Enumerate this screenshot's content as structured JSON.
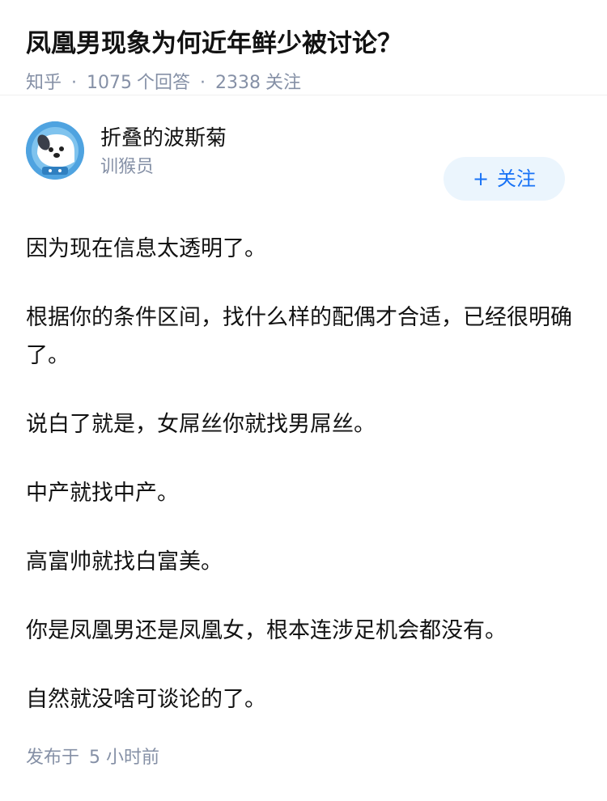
{
  "question": {
    "title": "凤凰男现象为何近年鲜少被讨论？",
    "source": "知乎",
    "answer_count": "1075",
    "answer_label": "个回答",
    "follow_count": "2338",
    "follow_label": "关注"
  },
  "author": {
    "name": "折叠的波斯菊",
    "tag": "训猴员",
    "avatar_icon": "astronaut-dog-avatar",
    "follow_button": "关注"
  },
  "answer": {
    "paragraphs": [
      "因为现在信息太透明了。",
      "根据你的条件区间，找什么样的配偶才合适，已经很明确了。",
      "说白了就是，女屌丝你就找男屌丝。",
      "中产就找中产。",
      "高富帅就找白富美。",
      "你是凤凰男还是凤凰女，根本连涉足机会都没有。",
      "自然就没啥可谈论的了。"
    ]
  },
  "footer": {
    "published_label": "发布于",
    "time": "5 小时前"
  },
  "colors": {
    "accent": "#1772f6",
    "button_bg": "#ebf5fd",
    "muted": "#8590a6"
  }
}
